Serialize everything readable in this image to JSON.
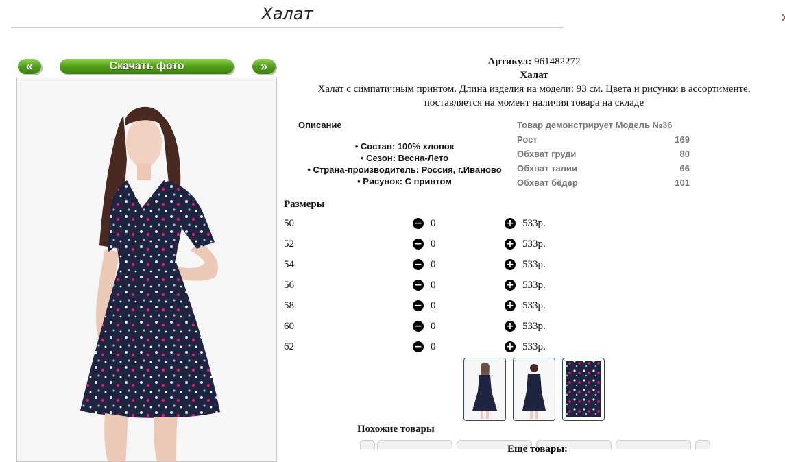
{
  "page": {
    "title": "Халат"
  },
  "nav": {
    "prev": "«",
    "download": "Скачать фото",
    "next": "»"
  },
  "product": {
    "article_label": "Артикул:",
    "article": "961482272",
    "name": "Халат",
    "text_line1": "Халат с симпатичным принтом. Длина изделия на модели: 93 см. Цвета и рисунки в ассортименте,",
    "text_line2": "поставляется на момент наличия товара на складе"
  },
  "description": {
    "title": "Описание",
    "items": [
      "Состав: 100% хлопок",
      "Сезон: Весна-Лето",
      "Страна-производитель: Россия, г.Иваново",
      "Рисунок: С принтом"
    ]
  },
  "model": {
    "heading": "Товар демонстрирует Модель №36",
    "rows": [
      {
        "label": "Рост",
        "value": "169"
      },
      {
        "label": "Обхват груди",
        "value": "80"
      },
      {
        "label": "Обхват талии",
        "value": "66"
      },
      {
        "label": "Обхват бёдер",
        "value": "101"
      }
    ]
  },
  "sizes": {
    "title": "Размеры",
    "rows": [
      {
        "size": "50",
        "qty": "0",
        "price": "533р."
      },
      {
        "size": "52",
        "qty": "0",
        "price": "533р."
      },
      {
        "size": "54",
        "qty": "0",
        "price": "533р."
      },
      {
        "size": "56",
        "qty": "0",
        "price": "533р."
      },
      {
        "size": "58",
        "qty": "0",
        "price": "533р."
      },
      {
        "size": "60",
        "qty": "0",
        "price": "533р."
      },
      {
        "size": "62",
        "qty": "0",
        "price": "533р."
      }
    ]
  },
  "icons": {
    "minus": "minus-circle-icon",
    "plus": "plus-circle-icon"
  },
  "similar": {
    "title": "Похожие товары"
  },
  "more": {
    "title": "Ещё товары:"
  },
  "colors": {
    "button_green": "#5aa820",
    "dress_navy": "#1f2440",
    "pink_print": "#d6206e"
  }
}
